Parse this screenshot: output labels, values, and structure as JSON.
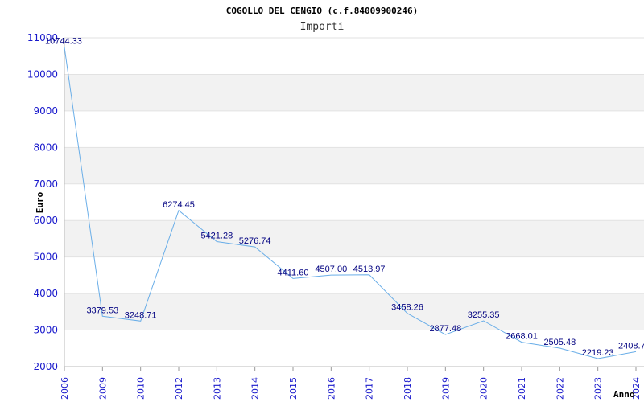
{
  "chart_data": {
    "type": "line",
    "title": "COGOLLO DEL CENGIO (c.f.84009900246)",
    "subtitle": "Importi",
    "xlabel": "Anno",
    "ylabel": "Euro",
    "categories": [
      "2006",
      "2009",
      "2010",
      "2012",
      "2013",
      "2014",
      "2015",
      "2016",
      "2017",
      "2018",
      "2019",
      "2020",
      "2021",
      "2022",
      "2023",
      "2024"
    ],
    "values": [
      10744.33,
      3379.53,
      3248.71,
      6274.45,
      5421.28,
      5276.74,
      4411.6,
      4507.0,
      4513.97,
      3458.26,
      2877.48,
      3255.35,
      2668.01,
      2505.48,
      2219.23,
      2408.7
    ],
    "value_labels": [
      "10744.33",
      "3379.53",
      "3248.71",
      "6274.45",
      "5421.28",
      "5276.74",
      "4411.60",
      "4507.00",
      "4513.97",
      "3458.26",
      "2877.48",
      "3255.35",
      "2668.01",
      "2505.48",
      "2219.23",
      "2408.7"
    ],
    "yticks": [
      "2000",
      "3000",
      "4000",
      "5000",
      "6000",
      "7000",
      "8000",
      "9000",
      "10000",
      "11000"
    ],
    "ylim": [
      2000,
      11000
    ],
    "grid": true,
    "colors": {
      "line": "#6aaee8",
      "band": "#f2f2f2",
      "tick_text": "#1a1acc",
      "label_text": "#000080"
    }
  }
}
